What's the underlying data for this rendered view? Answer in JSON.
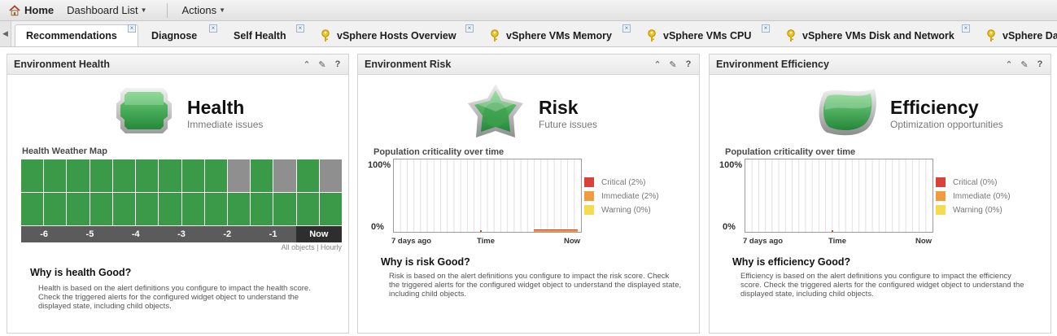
{
  "menubar": {
    "home": "Home",
    "dashboard_list": "Dashboard List",
    "actions": "Actions"
  },
  "tabs": [
    {
      "label": "Recommendations",
      "active": true,
      "closable": true,
      "key_icon": false
    },
    {
      "label": "Diagnose",
      "active": false,
      "closable": true,
      "key_icon": false
    },
    {
      "label": "Self Health",
      "active": false,
      "closable": true,
      "key_icon": false
    },
    {
      "label": "vSphere Hosts Overview",
      "active": false,
      "closable": true,
      "key_icon": true
    },
    {
      "label": "vSphere VMs Memory",
      "active": false,
      "closable": true,
      "key_icon": true
    },
    {
      "label": "vSphere VMs CPU",
      "active": false,
      "closable": true,
      "key_icon": true
    },
    {
      "label": "vSphere VMs Disk and Network",
      "active": false,
      "closable": true,
      "key_icon": true
    },
    {
      "label": "vSphere Da",
      "active": false,
      "closable": false,
      "key_icon": true
    }
  ],
  "colors": {
    "good_green": "#3a9a47",
    "gray_cell": "#8f8f8f",
    "critical": "#d9413a",
    "immediate": "#f29b3a",
    "warning": "#f4dc50",
    "widget_icon": "#3c9a45"
  },
  "health": {
    "title": "Environment Health",
    "big_title": "Health",
    "subtitle": "Immediate issues",
    "map_label": "Health Weather Map",
    "axis": [
      "-6",
      "-5",
      "-4",
      "-3",
      "-2",
      "-1",
      "Now"
    ],
    "note": "All objects | Hourly",
    "row1": [
      "g",
      "g",
      "g",
      "g",
      "g",
      "g",
      "g",
      "g",
      "g",
      "x",
      "g",
      "x",
      "g",
      "x"
    ],
    "row2": [
      "g",
      "g",
      "g",
      "g",
      "g",
      "g",
      "g",
      "g",
      "g",
      "g",
      "g",
      "g",
      "g",
      "g"
    ],
    "why_title": "Why is health Good?",
    "why_text": "Health is based on the alert definitions you configure to impact the health score. Check the triggered alerts for the configured widget object to understand the displayed state, including child objects."
  },
  "risk": {
    "title": "Environment Risk",
    "big_title": "Risk",
    "subtitle": "Future issues",
    "chart_label": "Population criticality over time",
    "y_top": "100%",
    "y_bottom": "0%",
    "x_left": "7 days ago",
    "x_mid": "Time",
    "x_right": "Now",
    "legend": [
      {
        "label": "Critical (2%)",
        "color": "#d9413a"
      },
      {
        "label": "Immediate (2%)",
        "color": "#f29b3a"
      },
      {
        "label": "Warning (0%)",
        "color": "#f4dc50"
      }
    ],
    "why_title": "Why is risk Good?",
    "why_text": "Risk is based on the alert definitions you configure to impact the risk score. Check the triggered alerts for the configured widget object to understand the displayed state, including child objects."
  },
  "efficiency": {
    "title": "Environment Efficiency",
    "big_title": "Efficiency",
    "subtitle": "Optimization opportunities",
    "chart_label": "Population criticality over time",
    "y_top": "100%",
    "y_bottom": "0%",
    "x_left": "7 days ago",
    "x_mid": "Time",
    "x_right": "Now",
    "legend": [
      {
        "label": "Critical (0%)",
        "color": "#d9413a"
      },
      {
        "label": "Immediate (0%)",
        "color": "#f29b3a"
      },
      {
        "label": "Warning (0%)",
        "color": "#f4dc50"
      }
    ],
    "why_title": "Why is efficiency Good?",
    "why_text": "Efficiency is based on the alert definitions you configure to impact the efficiency score. Check the triggered alerts for the configured widget object to understand the displayed state, including child objects."
  }
}
